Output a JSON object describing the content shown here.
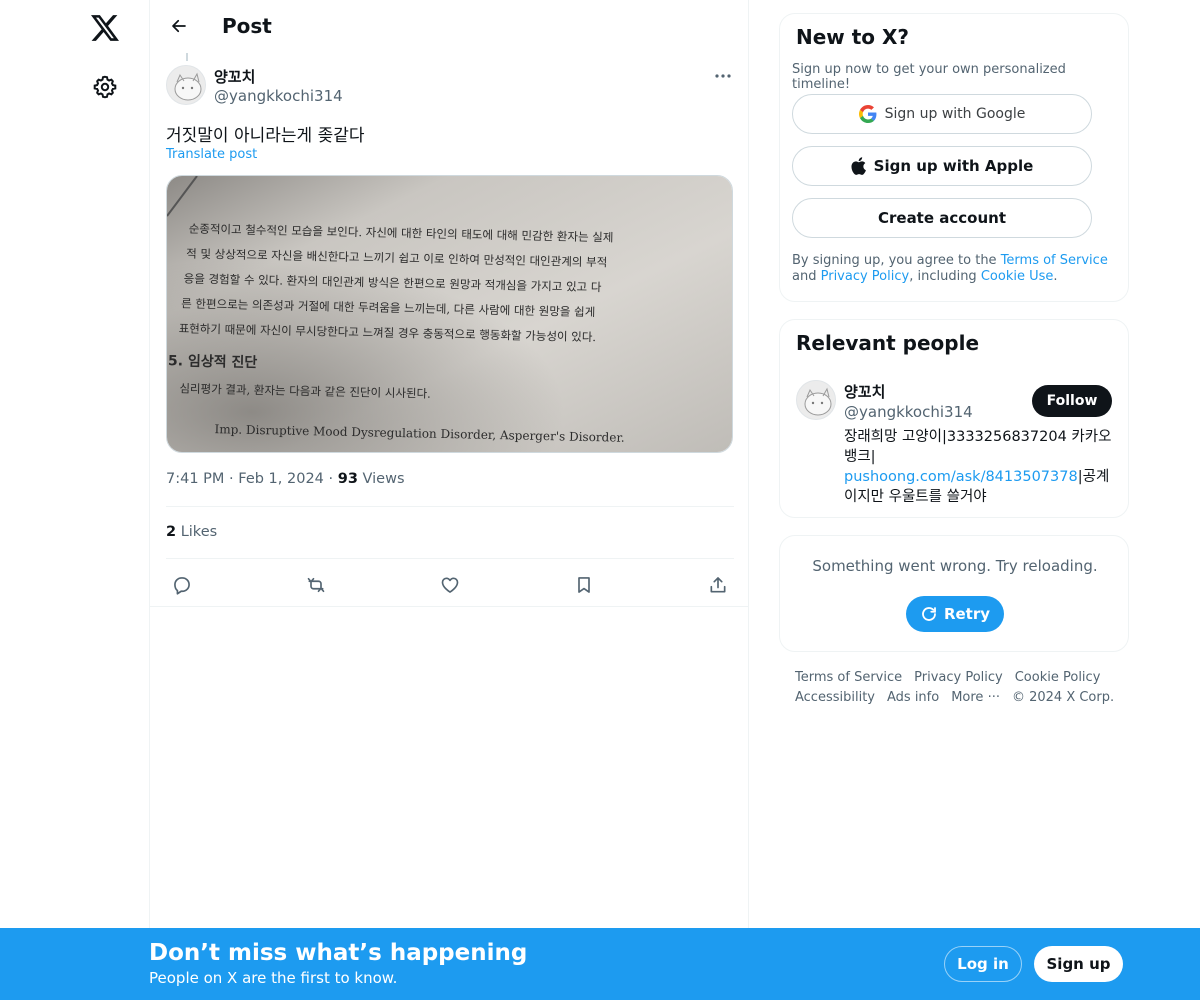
{
  "nav": {
    "logo_icon": "x-logo-icon",
    "settings_icon": "gear-icon"
  },
  "header": {
    "title": "Post",
    "back_icon": "arrow-left-icon"
  },
  "post": {
    "author_name": "양꼬치",
    "author_handle": "@yangkkochi314",
    "text": "거짓말이 아니라는게 좆같다",
    "translate_label": "Translate post",
    "image": {
      "lines": [
        "순종적이고 철수적인 모습을 보인다. 자신에 대한 타인의 태도에 대해 민감한 환자는 실제",
        "적 및 상상적으로 자신을 배신한다고 느끼기 쉽고 이로 인하여 만성적인 대인관계의 부적",
        "응을 경험할 수 있다. 환자의 대인관계 방식은 한편으로 원망과 적개심을 가지고 있고 다",
        "른 한편으로는 의존성과 거절에 대한 두려움을 느끼는데, 다른 사람에 대한 원망을 쉽게",
        "표현하기 때문에 자신이 무시당한다고 느껴질 경우 충동적으로 행동화할 가능성이 있다."
      ],
      "heading": "5. 임상적 진단",
      "diag_text": "심리평가 결과, 환자는 다음과 같은 진단이 시사된다.",
      "diagnosis": "Imp. Disruptive Mood Dysregulation Disorder, Asperger's Disorder."
    },
    "time": "7:41 PM",
    "date": "Feb 1, 2024",
    "views_count": "93",
    "views_label": "Views",
    "likes_count": "2",
    "likes_label": "Likes",
    "actions": [
      "reply-icon",
      "repost-icon",
      "like-icon",
      "bookmark-icon",
      "share-icon"
    ]
  },
  "signup_card": {
    "title": "New to X?",
    "subtitle": "Sign up now to get your own personalized timeline!",
    "google_label": "Sign up with Google",
    "apple_label": "Sign up with Apple",
    "create_label": "Create account",
    "legal_prefix": "By signing up, you agree to the ",
    "terms_link": "Terms of Service",
    "legal_and": " and",
    "privacy_link": "Privacy Policy",
    "legal_including": ", including ",
    "cookie_link": "Cookie Use",
    "legal_end": "."
  },
  "relevant_people": {
    "title": "Relevant people",
    "name": "양꼬치",
    "handle": "@yangkkochi314",
    "follow_label": "Follow",
    "bio_part1": "장래희망 고양이|3333256837204 카카오뱅크|",
    "bio_link": "pushoong.com/ask/8413507378",
    "bio_part2": "|공계이지만 우울트를 쓸거야"
  },
  "error_card": {
    "message": "Something went wrong. Try reloading.",
    "retry_label": "Retry"
  },
  "footer": {
    "terms": "Terms of Service",
    "privacy": "Privacy Policy",
    "cookie": "Cookie Policy",
    "accessibility": "Accessibility",
    "ads": "Ads info",
    "more": "More ···",
    "copyright": "© 2024 X Corp."
  },
  "banner": {
    "title": "Don’t miss what’s happening",
    "subtitle": "People on X are the first to know.",
    "login_label": "Log in",
    "signup_label": "Sign up"
  },
  "colors": {
    "accent": "#1d9bf0",
    "text_primary": "#0f1419",
    "text_secondary": "#536471",
    "border": "#eff3f4"
  }
}
